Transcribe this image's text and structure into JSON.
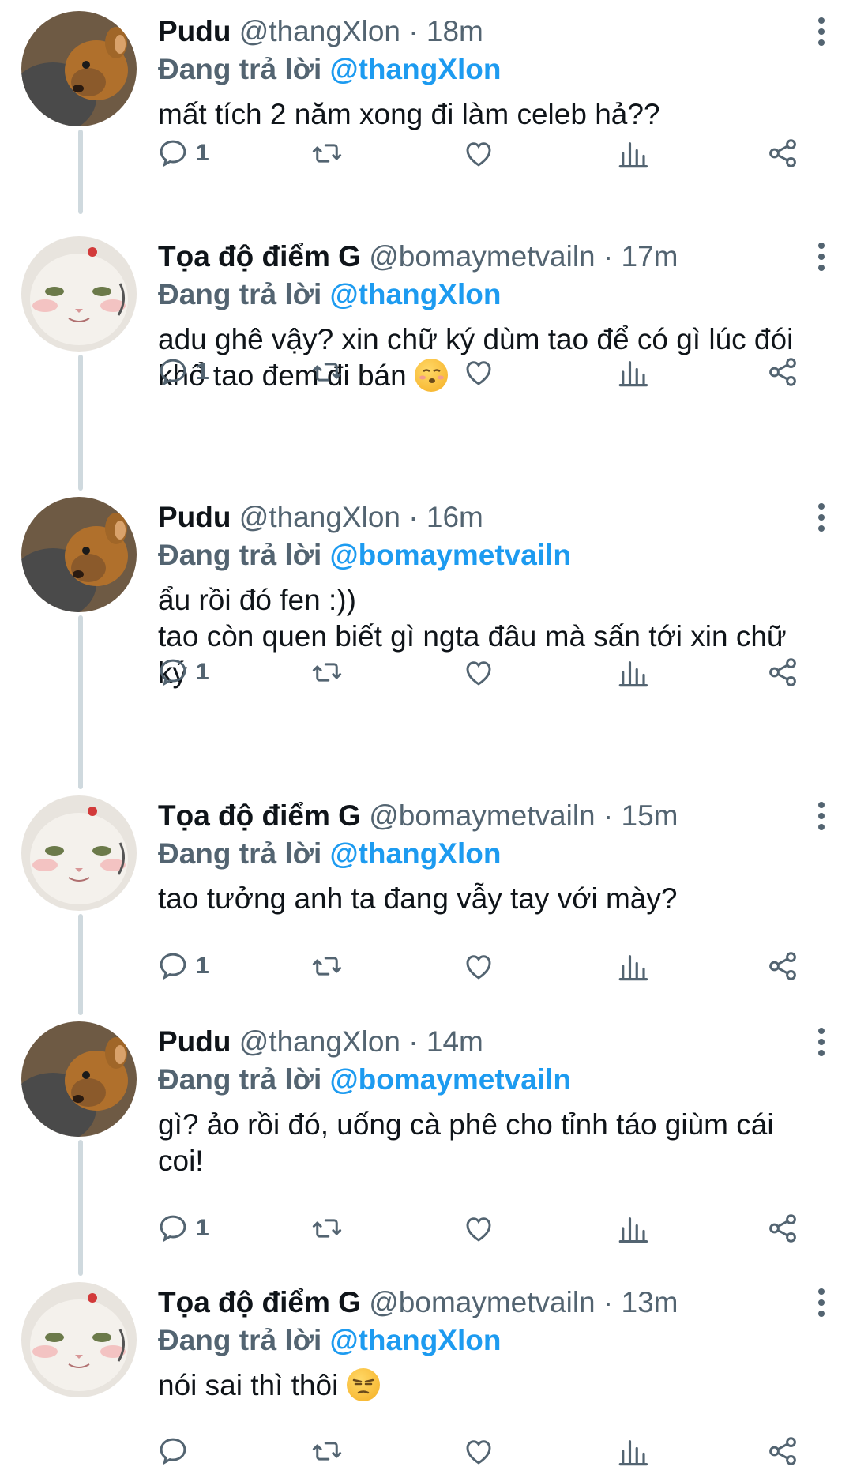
{
  "reply_prefix": "Đang trả lời",
  "colors": {
    "accent": "#1d9bf0",
    "muted": "#536471",
    "text": "#0f1419",
    "thread": "#cfd9de"
  },
  "tweets": [
    {
      "name": "Pudu",
      "handle": "@thangXlon",
      "time": "18m",
      "reply_to": "@thangXlon",
      "text": "mất tích 2 năm xong đi làm celeb hả??",
      "emoji": "",
      "reply_count": "1",
      "avatar": "deer-avatar"
    },
    {
      "name": "Tọa độ điểm G",
      "handle": "@bomaymetvailn",
      "time": "17m",
      "reply_to": "@thangXlon",
      "text": "adu ghê vậy? xin chữ ký dùm tao để có gì lúc đói\nkhổ tao đem đi bán ",
      "emoji": "kissing-face",
      "reply_count": "1",
      "avatar": "cat-avatar"
    },
    {
      "name": "Pudu",
      "handle": "@thangXlon",
      "time": "16m",
      "reply_to": "@bomaymetvailn",
      "text": "ẩu rồi đó fen :))\ntao còn quen biết gì ngta đâu mà sấn tới xin chữ\nký",
      "emoji": "",
      "reply_count": "1",
      "avatar": "deer-avatar"
    },
    {
      "name": "Tọa độ điểm G",
      "handle": "@bomaymetvailn",
      "time": "15m",
      "reply_to": "@thangXlon",
      "text": "tao tưởng anh ta đang vẫy tay với mày?",
      "emoji": "",
      "reply_count": "1",
      "avatar": "cat-avatar"
    },
    {
      "name": "Pudu",
      "handle": "@thangXlon",
      "time": "14m",
      "reply_to": "@bomaymetvailn",
      "text": "gì? ảo rồi đó, uống cà phê cho tỉnh táo giùm cái\ncoi!",
      "emoji": "",
      "reply_count": "1",
      "avatar": "deer-avatar"
    },
    {
      "name": "Tọa độ điểm G",
      "handle": "@bomaymetvailn",
      "time": "13m",
      "reply_to": "@thangXlon",
      "text": "nói sai thì thôi ",
      "emoji": "unamused-face",
      "reply_count": "",
      "avatar": "cat-avatar"
    }
  ],
  "icons": [
    "reply-icon",
    "retweet-icon",
    "like-icon",
    "analytics-icon",
    "share-icon",
    "more-icon"
  ]
}
